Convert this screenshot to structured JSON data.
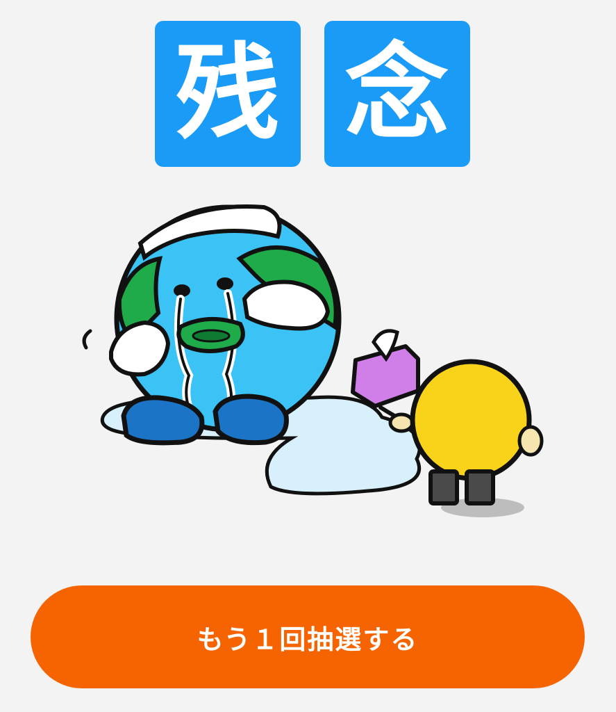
{
  "result": {
    "title_chars": [
      "残",
      "念"
    ]
  },
  "illustration": {
    "icon": "crying-earth-mascot-icon"
  },
  "actions": {
    "retry_label": "もう１回抽選する"
  },
  "colors": {
    "accent_blue": "#1a9bf7",
    "button_orange": "#f56400",
    "background": "#f3f3f3"
  }
}
